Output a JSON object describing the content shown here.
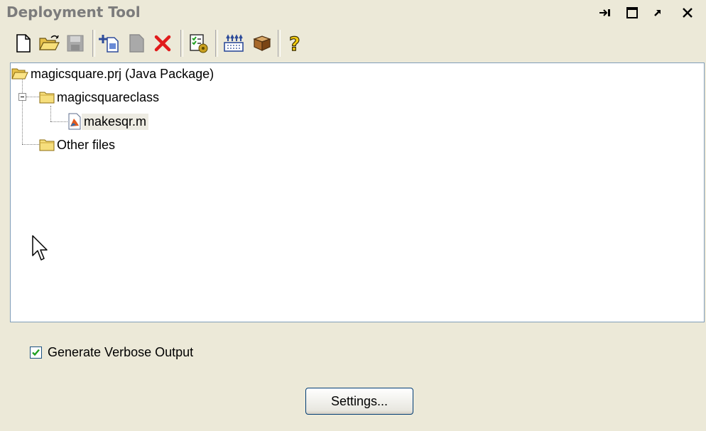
{
  "window": {
    "title": "Deployment Tool",
    "controls": [
      "pin-icon",
      "maximize-icon",
      "undock-icon",
      "close-icon"
    ]
  },
  "toolbar": {
    "buttons": [
      {
        "name": "new-project-button",
        "icon": "new-file-icon"
      },
      {
        "name": "open-project-button",
        "icon": "open-folder-icon"
      },
      {
        "name": "save-project-button",
        "icon": "save-icon",
        "disabled": true
      },
      {
        "name": "add-file-button",
        "icon": "add-file-icon"
      },
      {
        "name": "remove-file-button",
        "icon": "file-icon",
        "disabled": true
      },
      {
        "name": "delete-button",
        "icon": "delete-x-icon"
      },
      {
        "name": "build-button",
        "icon": "build-icon"
      },
      {
        "name": "package-button",
        "icon": "package-icon"
      },
      {
        "name": "box-button",
        "icon": "box-icon"
      },
      {
        "name": "help-button",
        "icon": "help-icon"
      }
    ]
  },
  "tree": {
    "root": "magicsquare.prj (Java Package)",
    "folder1": "magicsquareclass",
    "file1": "makesqr.m",
    "folder2": "Other files"
  },
  "options": {
    "verbose_label": "Generate Verbose Output",
    "verbose_checked": true
  },
  "actions": {
    "settings_label": "Settings..."
  },
  "colors": {
    "background": "#ECE9D8",
    "title_text": "#7C7C7C",
    "tree_border": "#7F9DB9",
    "selection": "#EDEBE2",
    "check_green": "#21A121",
    "delete_red": "#E11B1B"
  }
}
